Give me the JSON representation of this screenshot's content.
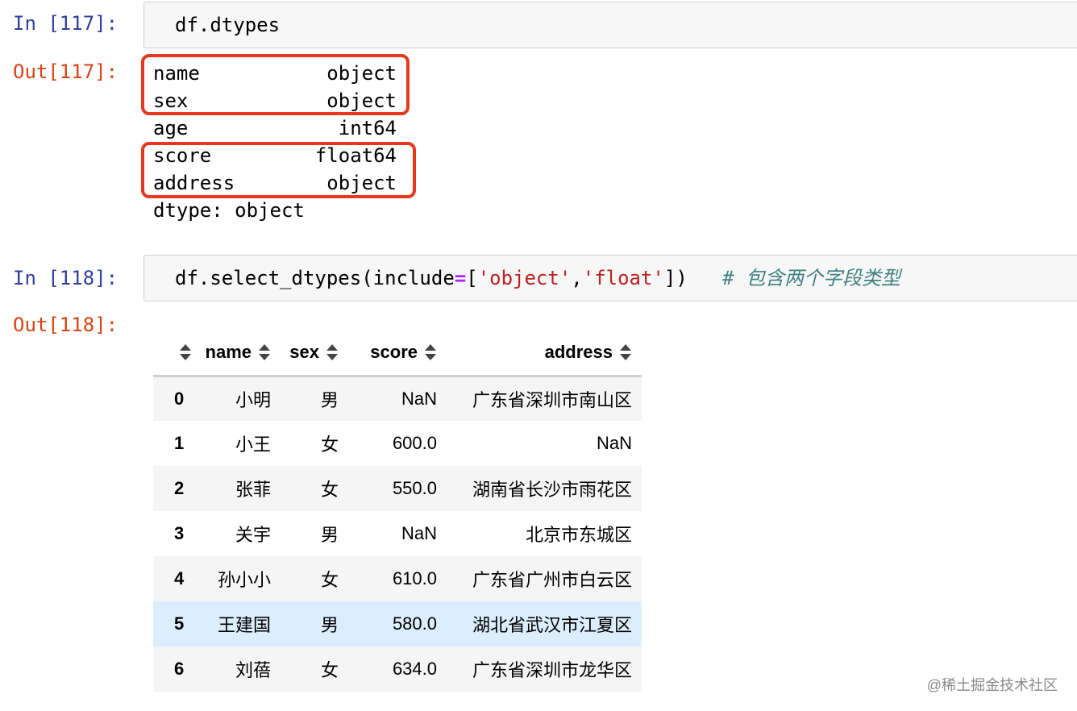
{
  "cell1": {
    "in_prompt": "In [117]:",
    "code": "df.dtypes",
    "out_prompt": "Out[117]:",
    "dtypes": [
      {
        "name": "name",
        "type": "object"
      },
      {
        "name": "sex",
        "type": "object"
      },
      {
        "name": "age",
        "type": "int64"
      },
      {
        "name": "score",
        "type": "float64"
      },
      {
        "name": "address",
        "type": "object"
      }
    ],
    "footer": "dtype: object",
    "highlight_color": "#e5391f"
  },
  "cell2": {
    "in_prompt": "In [118]:",
    "code": {
      "func": "df.select_dtypes(include",
      "op": "=",
      "open": "[",
      "str1": "'object'",
      "comma": ",",
      "str2": "'float'",
      "close": "])",
      "comment": "# 包含两个字段类型"
    },
    "out_prompt": "Out[118]:",
    "table": {
      "columns": [
        "name",
        "sex",
        "score",
        "address"
      ],
      "rows": [
        {
          "index": "0",
          "name": "小明",
          "sex": "男",
          "score": "NaN",
          "address": "广东省深圳市南山区"
        },
        {
          "index": "1",
          "name": "小王",
          "sex": "女",
          "score": "600.0",
          "address": "NaN"
        },
        {
          "index": "2",
          "name": "张菲",
          "sex": "女",
          "score": "550.0",
          "address": "湖南省长沙市雨花区"
        },
        {
          "index": "3",
          "name": "关宇",
          "sex": "男",
          "score": "NaN",
          "address": "北京市东城区"
        },
        {
          "index": "4",
          "name": "孙小小",
          "sex": "女",
          "score": "610.0",
          "address": "广东省广州市白云区"
        },
        {
          "index": "5",
          "name": "王建国",
          "sex": "男",
          "score": "580.0",
          "address": "湖北省武汉市江夏区"
        },
        {
          "index": "6",
          "name": "刘蓓",
          "sex": "女",
          "score": "634.0",
          "address": "广东省深圳市龙华区"
        }
      ]
    }
  },
  "watermark": "@稀土掘金技术社区"
}
